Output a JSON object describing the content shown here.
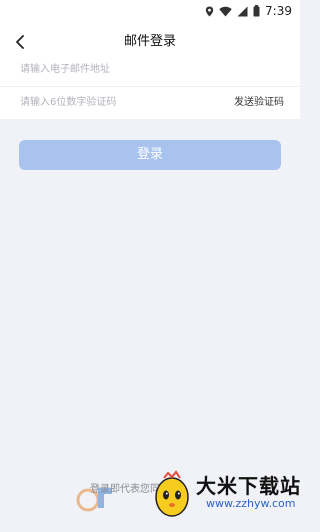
{
  "status_bar": {
    "time": "7:39",
    "icons": [
      "location-icon",
      "wifi-icon",
      "signal-icon",
      "battery-icon"
    ]
  },
  "nav": {
    "title": "邮件登录",
    "back_icon": "chevron-left-icon"
  },
  "form": {
    "email_placeholder": "请输入电子邮件地址",
    "code_placeholder": "请输入6位数字验证码",
    "send_code_label": "发送验证码"
  },
  "login_button": {
    "label": "登录"
  },
  "agreement": {
    "text": "登录即代表您同意"
  },
  "watermark": {
    "brand_text": "大米下载站",
    "url": "www.zzhyw.com"
  },
  "colors": {
    "background": "#f1f2f7",
    "button": "#a8c3ee",
    "placeholder": "#b2b4bc"
  }
}
